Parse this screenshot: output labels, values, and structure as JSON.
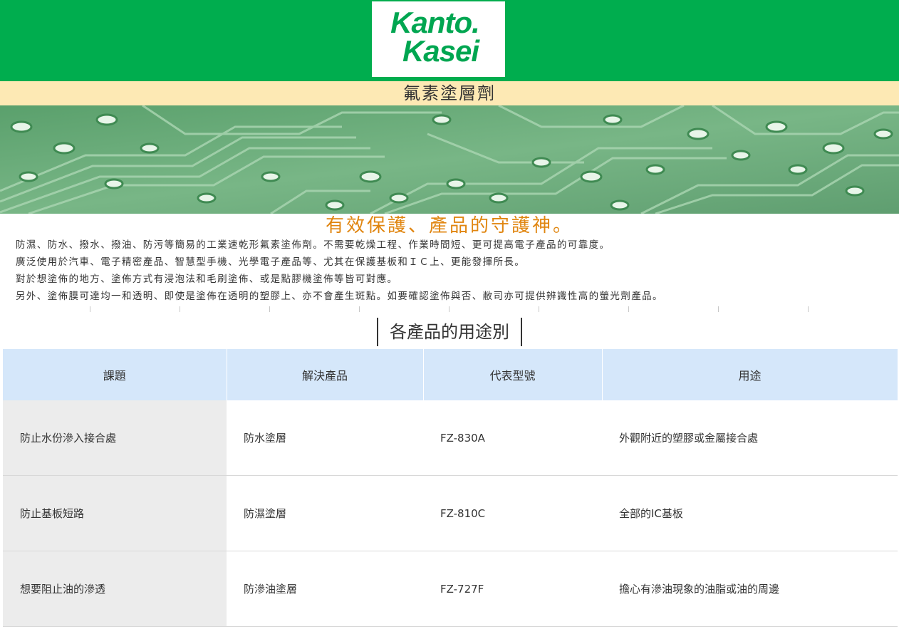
{
  "logo": {
    "line1": "Kanto.",
    "line2": "Kasei"
  },
  "page_title": "氟素塗層劑",
  "tagline": "有效保護、產品的守護神。",
  "description": [
    "防濕、防水、撥水、撥油、防污等簡易的工業速乾形氟素塗佈劑。不需要乾燥工程、作業時間短、更可提高電子產品的可靠度。",
    "廣泛使用於汽車、電子精密產品、智慧型手機、光學電子產品等、尤其在保護基板和ＩＣ上、更能發揮所長。",
    "對於想塗佈的地方、塗佈方式有浸泡法和毛刷塗佈、或是點膠機塗佈等皆可對應。",
    "另外、塗佈膜可達均一和透明、即使是塗佈在透明的塑膠上、亦不會產生斑點。如要確認塗佈與否、敝司亦可提供辨識性高的螢光劑產品。"
  ],
  "section_title": "各產品的用途別",
  "table": {
    "headers": [
      "課題",
      "解決產品",
      "代表型號",
      "用途"
    ],
    "rows": [
      [
        "防止水份滲入接合處",
        "防水塗層",
        "FZ-830A",
        "外觀附近的塑膠或金屬接合處"
      ],
      [
        "防止基板短路",
        "防濕塗層",
        "FZ-810C",
        "全部的IC基板"
      ],
      [
        "想要阻止油的滲透",
        "防滲油塗層",
        "FZ-727F",
        "擔心有滲油現象的油脂或油的周邊"
      ]
    ]
  },
  "colors": {
    "header_green": "#00ad4e",
    "title_bar": "#fde9b4",
    "tagline": "#e0850f",
    "table_header": "#d5e7fa",
    "first_column": "#ececec"
  }
}
